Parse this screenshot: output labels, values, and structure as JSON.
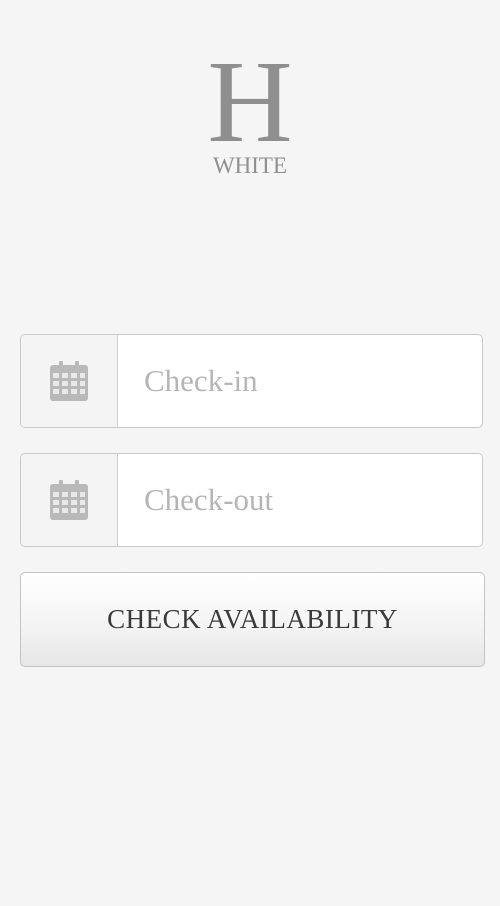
{
  "logo": {
    "letter": "H",
    "word": "WHITE"
  },
  "checkin": {
    "placeholder": "Check-in",
    "icon": "calendar-icon"
  },
  "checkout": {
    "placeholder": "Check-out",
    "icon": "calendar-icon"
  },
  "action": {
    "label": "CHECK AVAILABILITY"
  },
  "colors": {
    "background": "#f5f5f5",
    "logo": "#8f8f8f",
    "icon": "#b9b9b9",
    "placeholder": "#b5b5b5",
    "button_text": "#3a3a3a"
  }
}
